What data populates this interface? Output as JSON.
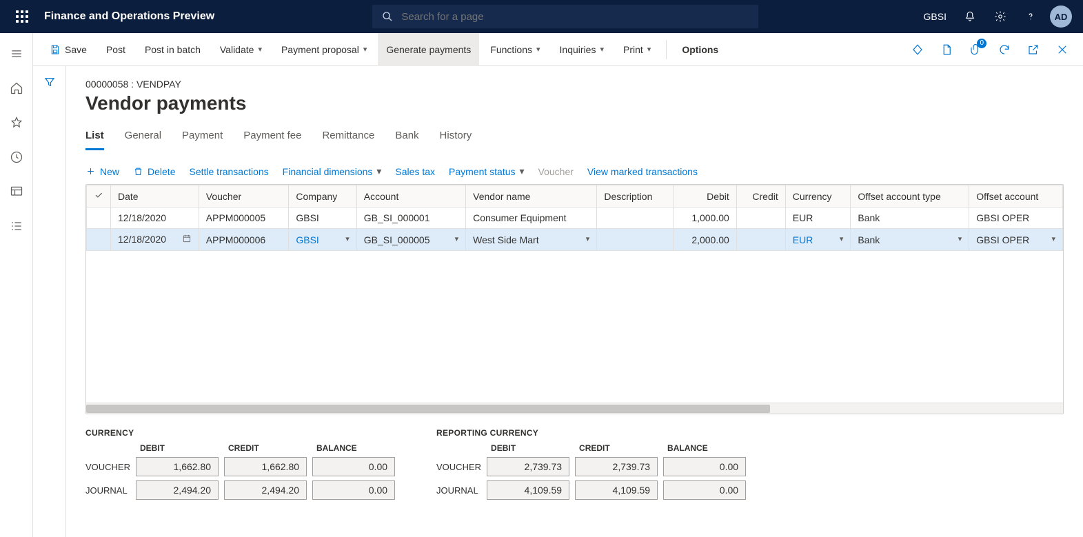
{
  "app": {
    "title": "Finance and Operations Preview",
    "search_placeholder": "Search for a page",
    "company": "GBSI",
    "avatar": "AD"
  },
  "actionbar": {
    "save": "Save",
    "post": "Post",
    "post_batch": "Post in batch",
    "validate": "Validate",
    "payment_proposal": "Payment proposal",
    "generate_payments": "Generate payments",
    "functions": "Functions",
    "inquiries": "Inquiries",
    "print": "Print",
    "options": "Options",
    "badge": "0"
  },
  "page": {
    "breadcrumb": "00000058 : VENDPAY",
    "title": "Vendor payments",
    "tabs": [
      "List",
      "General",
      "Payment",
      "Payment fee",
      "Remittance",
      "Bank",
      "History"
    ],
    "active_tab": 0
  },
  "toolbar": {
    "new": "New",
    "delete": "Delete",
    "settle": "Settle transactions",
    "fin_dim": "Financial dimensions",
    "sales_tax": "Sales tax",
    "payment_status": "Payment status",
    "voucher": "Voucher",
    "view_marked": "View marked transactions"
  },
  "grid": {
    "headers": [
      "Date",
      "Voucher",
      "Company",
      "Account",
      "Vendor name",
      "Description",
      "Debit",
      "Credit",
      "Currency",
      "Offset account type",
      "Offset account"
    ],
    "rows": [
      {
        "date": "12/18/2020",
        "voucher": "APPM000005",
        "company": "GBSI",
        "account": "GB_SI_000001",
        "vendor": "Consumer Equipment",
        "description": "",
        "debit": "1,000.00",
        "credit": "",
        "currency": "EUR",
        "oat": "Bank",
        "oa": "GBSI OPER",
        "selected": false
      },
      {
        "date": "12/18/2020",
        "voucher": "APPM000006",
        "company": "GBSI",
        "account": "GB_SI_000005",
        "vendor": "West Side Mart",
        "description": "",
        "debit": "2,000.00",
        "credit": "",
        "currency": "EUR",
        "oat": "Bank",
        "oa": "GBSI OPER",
        "selected": true
      }
    ]
  },
  "totals": {
    "currency_label": "CURRENCY",
    "reporting_label": "REPORTING CURRENCY",
    "col_headers": [
      "DEBIT",
      "CREDIT",
      "BALANCE"
    ],
    "row_labels": [
      "VOUCHER",
      "JOURNAL"
    ],
    "currency": {
      "voucher": {
        "debit": "1,662.80",
        "credit": "1,662.80",
        "balance": "0.00"
      },
      "journal": {
        "debit": "2,494.20",
        "credit": "2,494.20",
        "balance": "0.00"
      }
    },
    "reporting": {
      "voucher": {
        "debit": "2,739.73",
        "credit": "2,739.73",
        "balance": "0.00"
      },
      "journal": {
        "debit": "4,109.59",
        "credit": "4,109.59",
        "balance": "0.00"
      }
    }
  }
}
